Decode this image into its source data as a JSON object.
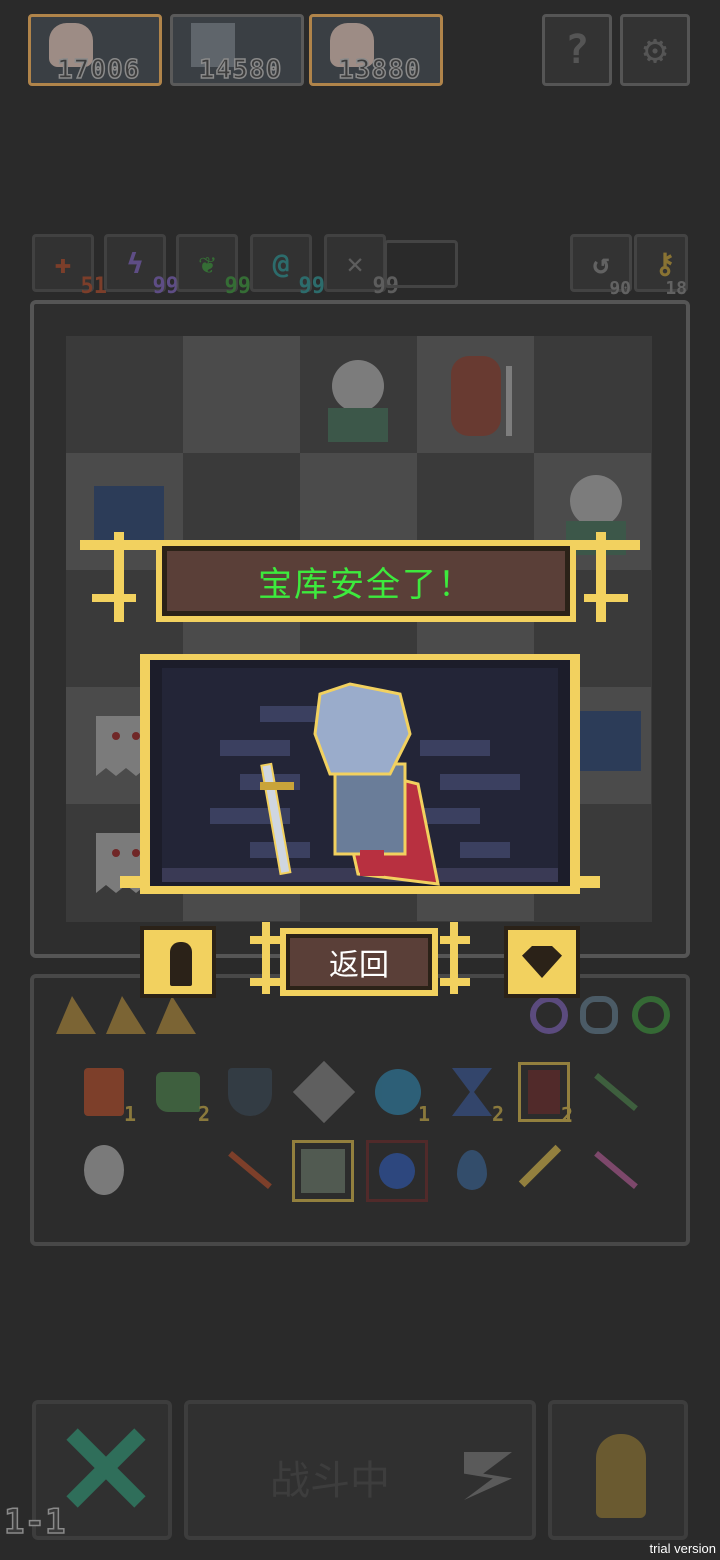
{
  "party": [
    {
      "name": "hero-portrait-1",
      "score": "17006",
      "border": "#b0844a",
      "face": "#c9a0a0"
    },
    {
      "name": "hero-portrait-2",
      "score": "14580",
      "border": "#6a6a6a",
      "face": "#7a7f85"
    },
    {
      "name": "hero-portrait-3",
      "score": "13880",
      "border": "#b0844a",
      "face": "#c9a0a0"
    }
  ],
  "top_buttons": {
    "help_glyph": "?",
    "settings_glyph": "⚙"
  },
  "resources": [
    {
      "name": "attack",
      "glyph": "✚",
      "count": "51",
      "color": "#c0502a"
    },
    {
      "name": "lightning",
      "glyph": "ϟ",
      "count": "99",
      "color": "#8a6ad0"
    },
    {
      "name": "nature",
      "glyph": "❦",
      "count": "99",
      "color": "#3ea53e"
    },
    {
      "name": "arcane",
      "glyph": "@",
      "count": "99",
      "color": "#2fa3a3"
    },
    {
      "name": "wind",
      "glyph": "✕",
      "count": "99",
      "color": "#888888"
    }
  ],
  "right_counters": [
    {
      "name": "turns",
      "glyph": "↺",
      "count": "90"
    },
    {
      "name": "keys",
      "glyph": "⚷",
      "count": "18"
    }
  ],
  "modal": {
    "title": "宝库安全了！",
    "back_label": "返回"
  },
  "inventory_counts": {
    "a": "1",
    "b": "2",
    "c": "1",
    "d": "2",
    "e": "2"
  },
  "bottom": {
    "battle_label": "战斗中",
    "level": "1-1"
  },
  "trial": "trial version",
  "colors": {
    "gold": "#f2d15f",
    "panel": "#5a3f38",
    "green_text": "#3dea3d"
  }
}
